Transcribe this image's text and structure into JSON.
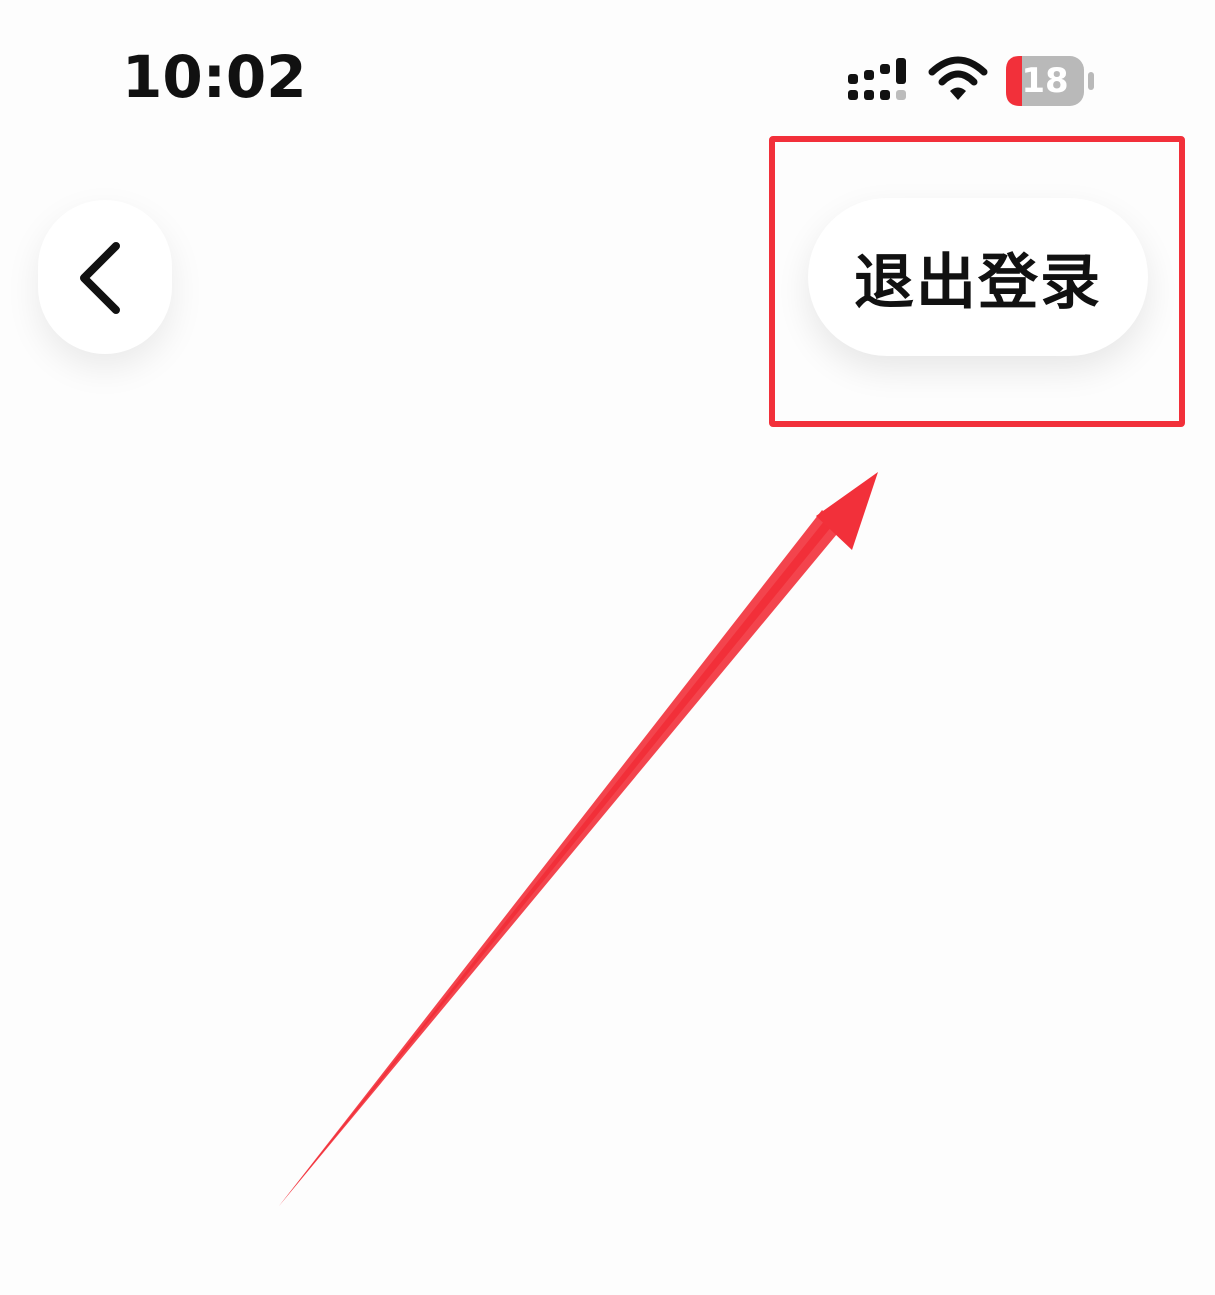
{
  "status_bar": {
    "time": "10:02",
    "signal_icon": "cellular-signal-icon",
    "wifi_icon": "wifi-icon",
    "battery_icon": "battery-icon",
    "battery_level": "18",
    "battery_color": "#f2303a"
  },
  "nav": {
    "back_icon": "chevron-left-icon",
    "logout_label": "退出登录"
  },
  "annotation": {
    "highlight_color": "#f2303a",
    "arrow_icon": "arrow-icon"
  }
}
